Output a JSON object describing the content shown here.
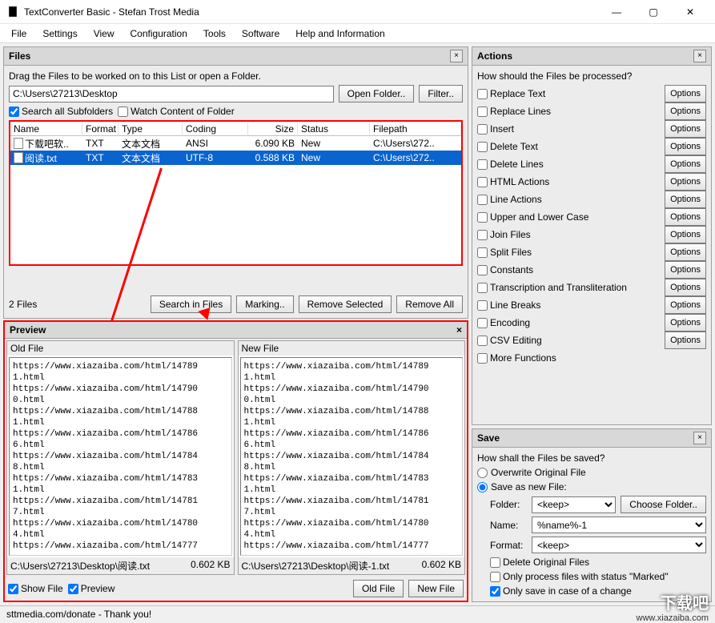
{
  "title": "TextConverter Basic - Stefan Trost Media",
  "menu": [
    "File",
    "Settings",
    "View",
    "Configuration",
    "Tools",
    "Software",
    "Help and Information"
  ],
  "files": {
    "panel_title": "Files",
    "hint": "Drag the Files to be worked on to this List or open a Folder.",
    "path": "C:\\Users\\27213\\Desktop",
    "open_folder": "Open Folder..",
    "filter": "Filter..",
    "search_sub": "Search all Subfolders",
    "watch": "Watch Content of Folder",
    "cols": {
      "name": "Name",
      "format": "Format",
      "type": "Type",
      "coding": "Coding",
      "size": "Size",
      "status": "Status",
      "filepath": "Filepath"
    },
    "rows": [
      {
        "name": "下载吧软..",
        "format": "TXT",
        "type": "文本文档",
        "coding": "ANSI",
        "size": "6.090 KB",
        "status": "New",
        "filepath": "C:\\Users\\272..",
        "selected": false
      },
      {
        "name": "阅读.txt",
        "format": "TXT",
        "type": "文本文档",
        "coding": "UTF-8",
        "size": "0.588 KB",
        "status": "New",
        "filepath": "C:\\Users\\272..",
        "selected": true
      }
    ],
    "count": "2 Files",
    "btn_search": "Search in Files",
    "btn_mark": "Marking..",
    "btn_remove": "Remove Selected",
    "btn_remove_all": "Remove All"
  },
  "preview": {
    "panel_title": "Preview",
    "old_label": "Old File",
    "new_label": "New File",
    "content": "https://www.xiazaiba.com/html/14789\n1.html\nhttps://www.xiazaiba.com/html/14790\n0.html\nhttps://www.xiazaiba.com/html/14788\n1.html\nhttps://www.xiazaiba.com/html/14786\n6.html\nhttps://www.xiazaiba.com/html/14784\n8.html\nhttps://www.xiazaiba.com/html/14783\n1.html\nhttps://www.xiazaiba.com/html/14781\n7.html\nhttps://www.xiazaiba.com/html/14780\n4.html\nhttps://www.xiazaiba.com/html/14777",
    "old_path": "C:\\Users\\27213\\Desktop\\阅读.txt",
    "old_size": "0.602 KB",
    "new_path": "C:\\Users\\27213\\Desktop\\阅读-1.txt",
    "new_size": "0.602 KB",
    "show_file": "Show File",
    "preview_chk": "Preview",
    "btn_old": "Old File",
    "btn_new": "New File"
  },
  "actions": {
    "panel_title": "Actions",
    "hint": "How should the Files be processed?",
    "items": [
      "Replace Text",
      "Replace Lines",
      "Insert",
      "Delete Text",
      "Delete Lines",
      "HTML Actions",
      "Line Actions",
      "Upper and Lower Case",
      "Join Files",
      "Split Files",
      "Constants",
      "Transcription and Transliteration",
      "Line Breaks",
      "Encoding",
      "CSV Editing",
      "More Functions"
    ],
    "options": "Options"
  },
  "save": {
    "panel_title": "Save",
    "hint": "How shall the Files be saved?",
    "overwrite": "Overwrite Original File",
    "savenew": "Save as new File:",
    "folder_lbl": "Folder:",
    "folder_val": "<keep>",
    "choose": "Choose Folder..",
    "name_lbl": "Name:",
    "name_val": "%name%-1",
    "format_lbl": "Format:",
    "format_val": "<keep>",
    "del_orig": "Delete Original Files",
    "only_marked": "Only process files with status \"Marked\"",
    "only_change": "Only save in case of a change"
  },
  "status": "sttmedia.com/donate - Thank you!",
  "watermark": "下载吧",
  "watermark_url": "www.xiazaiba.com"
}
